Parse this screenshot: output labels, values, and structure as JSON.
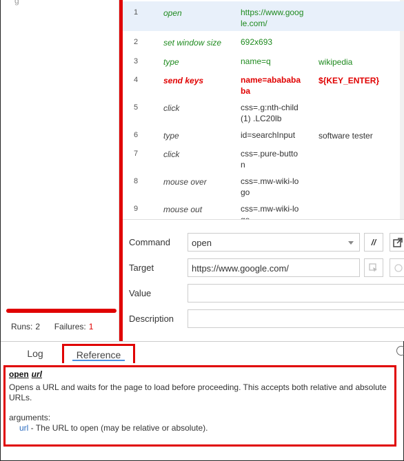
{
  "test_panel": {
    "top_text": "g",
    "runs_label": "Runs:",
    "runs_value": "2",
    "failures_label": "Failures:",
    "failures_value": "1",
    "progress_failed_fraction": 1.0
  },
  "commands": [
    {
      "num": "1",
      "command": "open",
      "target": "https://www.google.com/",
      "value": "",
      "state": "green"
    },
    {
      "num": "2",
      "command": "set window size",
      "target": "692x693",
      "value": "",
      "state": "green"
    },
    {
      "num": "3",
      "command": "type",
      "target": "name=q",
      "value": "wikipedia",
      "state": "green"
    },
    {
      "num": "4",
      "command": "send keys",
      "target": "name=abababa ba",
      "value": "${KEY_ENTER}",
      "state": "error"
    },
    {
      "num": "5",
      "command": "click",
      "target": "css=.g:nth-child (1) .LC20lb",
      "value": "",
      "state": "normal"
    },
    {
      "num": "6",
      "command": "type",
      "target": "id=searchInput",
      "value": "software tester",
      "state": "normal"
    },
    {
      "num": "7",
      "command": "click",
      "target": "css=.pure-butto n",
      "value": "",
      "state": "normal"
    },
    {
      "num": "8",
      "command": "mouse over",
      "target": "css=.mw-wiki-lo go",
      "value": "",
      "state": "normal"
    },
    {
      "num": "9",
      "command": "mouse out",
      "target": "css=.mw-wiki-lo go",
      "value": "",
      "state": "normal"
    }
  ],
  "editor": {
    "command_label": "Command",
    "command_value": "open",
    "comment_button": "//",
    "target_label": "Target",
    "target_value": "https://www.google.com/",
    "value_label": "Value",
    "value_value": "",
    "description_label": "Description",
    "description_value": ""
  },
  "bottom_tabs": {
    "log": "Log",
    "reference": "Reference"
  },
  "reference": {
    "command": "open",
    "argument": "url",
    "description": "Opens a URL and waits for the page to load before proceeding. This accepts both relative and absolute URLs.",
    "arguments_label": "arguments:",
    "arg_name": "url",
    "arg_desc": " - The URL to open (may be relative or absolute)."
  },
  "colors": {
    "pass": "#1f8a1f",
    "fail": "#e00000",
    "annotation": "#e00000",
    "selected_row": "#e8f0fa",
    "link": "#2a6bbf"
  }
}
